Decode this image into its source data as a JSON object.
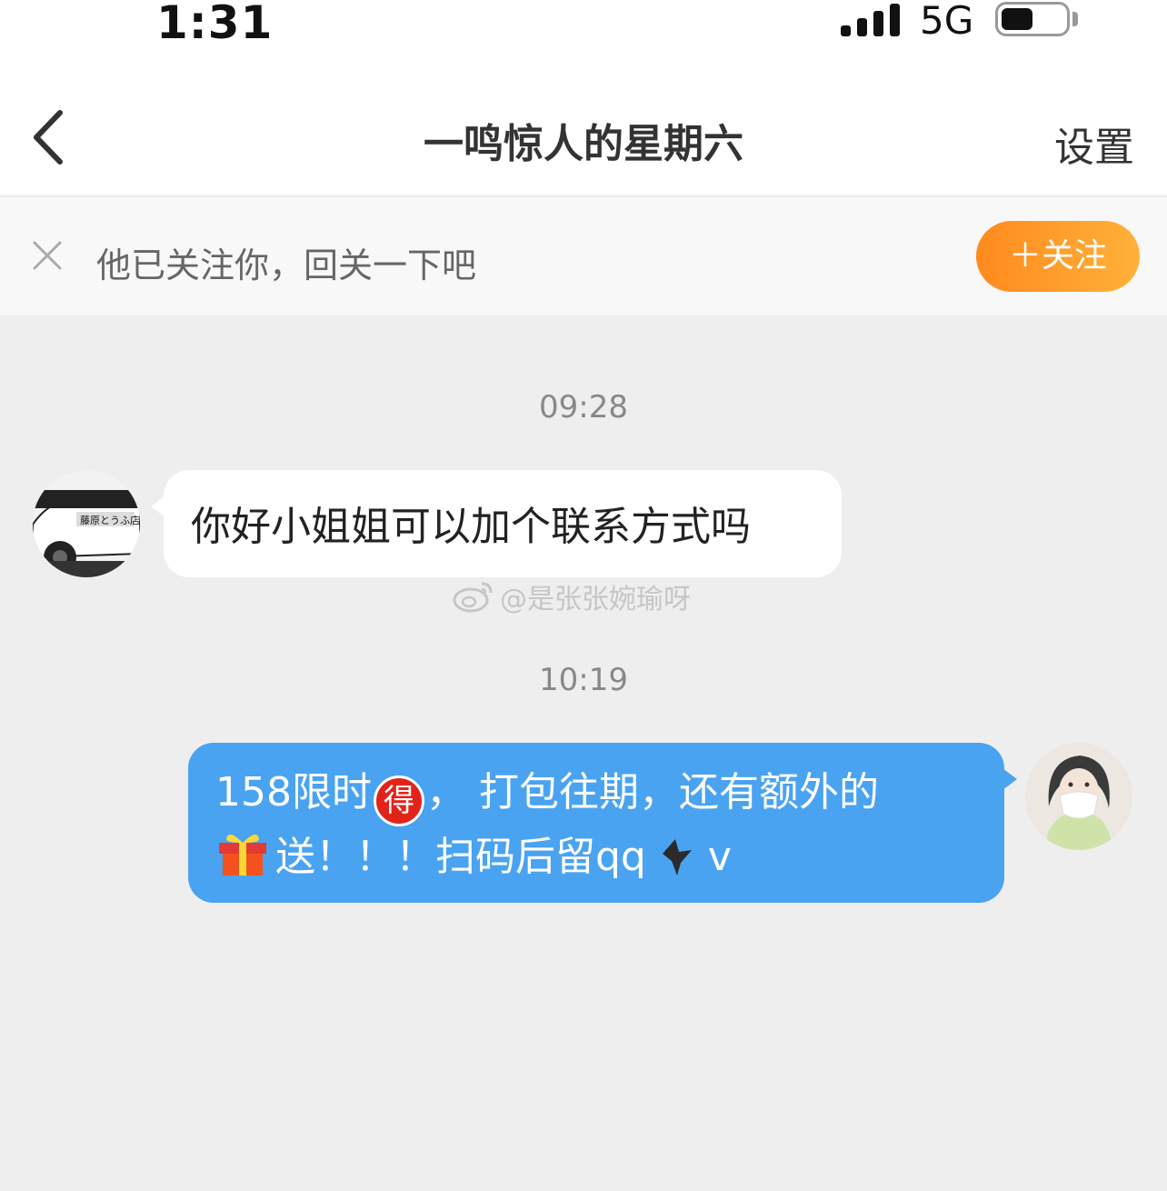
{
  "status_bar": {
    "time": "1:31",
    "network": "5G",
    "battery_level": 0.5
  },
  "nav": {
    "title": "一鸣惊人的星期六",
    "settings_label": "设置",
    "back_icon": "chevron-left-icon"
  },
  "follow_prompt": {
    "text": "他已关注你，回关一下吧",
    "button_label": "＋关注",
    "accent_color": "#ff9a2a"
  },
  "messages": [
    {
      "timestamp": "09:28",
      "direction": "incoming",
      "text": "你好小姐姐可以加个联系方式吗"
    },
    {
      "timestamp": "10:19",
      "direction": "outgoing",
      "line1_before": "158限时",
      "line1_emoji": "得",
      "line1_after": "， 打包往期，还有额外的",
      "line2_text": "送！！！扫码后留qq",
      "line2_tail": "v",
      "bubble_color": "#4aa3f0"
    }
  ],
  "watermark": {
    "text": "@是张张婉瑜呀"
  }
}
